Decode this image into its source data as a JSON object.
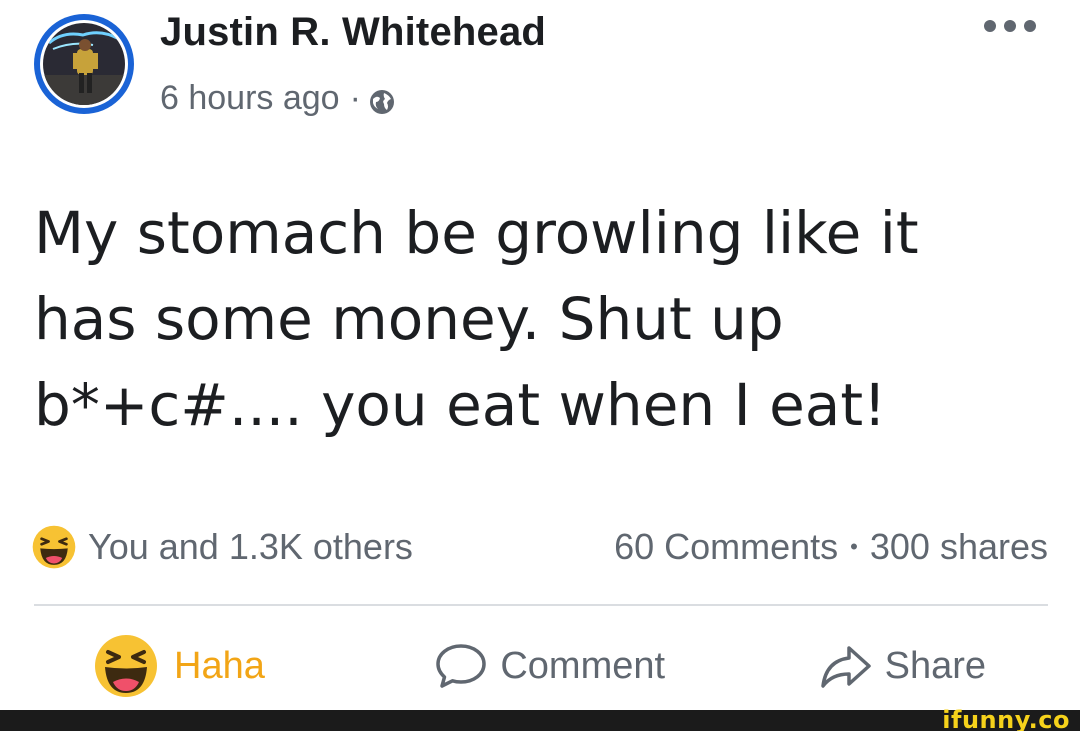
{
  "post": {
    "author_name": "Justin R. Whitehead",
    "timestamp": "6 hours ago",
    "separator": "·",
    "privacy_icon": "globe-icon",
    "more_icon": "more-options-icon",
    "text_lines": [
      "My stomach be growling like it",
      "has some money. Shut up",
      "b*+c#.... you eat when I eat!"
    ]
  },
  "reactions": {
    "icon": "haha-reaction-icon",
    "summary": "You and 1.3K others",
    "comments": "60 Comments",
    "dot": "•",
    "shares": "300 shares"
  },
  "actions": {
    "haha_label": "Haha",
    "comment_label": "Comment",
    "share_label": "Share"
  },
  "colors": {
    "avatar_ring": "#1a63d6",
    "haha_active": "#f2a516",
    "secondary_text": "#606770",
    "watermark": "#f6d21b"
  },
  "watermark": {
    "text": "ifunny.co"
  }
}
